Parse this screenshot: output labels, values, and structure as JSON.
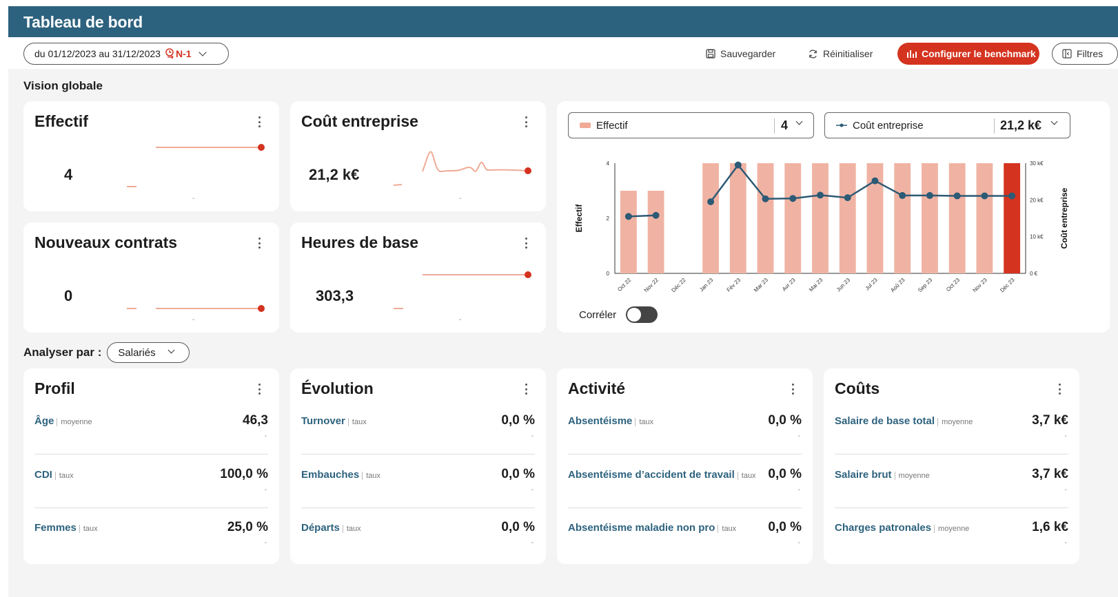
{
  "header": {
    "title": "Tableau de bord"
  },
  "toolbar": {
    "date_range": "du 01/12/2023 au 31/12/2023",
    "compare_label": "N-1",
    "save_label": "Sauvegarder",
    "reset_label": "Réinitialiser",
    "benchmark_label": "Configurer le benchmark",
    "filters_label": "Filtres"
  },
  "global_section": {
    "title": "Vision globale"
  },
  "kpis": [
    {
      "title": "Effectif",
      "value": "4",
      "trend_dash": "-"
    },
    {
      "title": "Coût entreprise",
      "value": "21,2 k€",
      "trend_dash": "-"
    },
    {
      "title": "Nouveaux contrats",
      "value": "0",
      "trend_dash": "-"
    },
    {
      "title": "Heures de base",
      "value": "303,3",
      "trend_dash": "-"
    }
  ],
  "chart_selectors": {
    "left": {
      "label": "Effectif",
      "value": "4"
    },
    "right": {
      "label": "Coût entreprise",
      "value": "21,2 k€"
    }
  },
  "correlate_label": "Corréler",
  "chart_data": {
    "type": "bar",
    "categories": [
      "Oct 22",
      "Nov 22",
      "Déc 22",
      "Jan 23",
      "Fév 23",
      "Mar 23",
      "Avr 23",
      "Mai 23",
      "Jun 23",
      "Jul 23",
      "Aoû 23",
      "Sep 23",
      "Oct 23",
      "Nov 23",
      "Déc 23"
    ],
    "series": [
      {
        "name": "Effectif",
        "type": "bar",
        "axis": "left",
        "values": [
          3,
          3,
          0,
          4,
          4,
          4,
          4,
          4,
          4,
          4,
          4,
          4,
          4,
          4,
          4
        ]
      },
      {
        "name": "Coût entreprise",
        "type": "line",
        "axis": "right",
        "values": [
          15.5,
          15.8,
          null,
          19.5,
          29.5,
          20.3,
          20.4,
          21.3,
          20.6,
          25.2,
          21.2,
          21.2,
          21.1,
          21.1,
          21.1
        ]
      }
    ],
    "highlight_index": 14,
    "ylabel": "Effectif",
    "ylabel_right": "Coût entreprise",
    "yticks_left": [
      "0",
      "2",
      "4"
    ],
    "yticks_right": [
      "0 €",
      "10 k€",
      "20 k€",
      "30 k€"
    ],
    "ylim": [
      0,
      4
    ],
    "ylim_right": [
      0,
      30
    ],
    "colors": {
      "bar": "#f0b3a3",
      "bar_highlight": "#d4331f",
      "line": "#2d5a75"
    }
  },
  "analyse": {
    "label": "Analyser par :",
    "value": "Salariés"
  },
  "metric_cards": [
    {
      "title": "Profil",
      "rows": [
        {
          "name": "Âge",
          "tag": "moyenne",
          "value": "46,3",
          "dash": "-"
        },
        {
          "name": "CDI",
          "tag": "taux",
          "value": "100,0 %",
          "dash": "-"
        },
        {
          "name": "Femmes",
          "tag": "taux",
          "value": "25,0 %",
          "dash": "-"
        }
      ]
    },
    {
      "title": "Évolution",
      "rows": [
        {
          "name": "Turnover",
          "tag": "taux",
          "value": "0,0 %",
          "dash": "-"
        },
        {
          "name": "Embauches",
          "tag": "taux",
          "value": "0,0 %",
          "dash": "-"
        },
        {
          "name": "Départs",
          "tag": "taux",
          "value": "0,0 %",
          "dash": "-"
        }
      ]
    },
    {
      "title": "Activité",
      "rows": [
        {
          "name": "Absentéisme",
          "tag": "taux",
          "value": "0,0 %",
          "dash": "-"
        },
        {
          "name": "Absentéisme d’accident de travail",
          "tag": "taux",
          "value": "0,0 %",
          "dash": "-"
        },
        {
          "name": "Absentéisme maladie non pro",
          "tag": "taux",
          "value": "0,0 %",
          "dash": "-"
        }
      ]
    },
    {
      "title": "Coûts",
      "rows": [
        {
          "name": "Salaire de base total",
          "tag": "moyenne",
          "value": "3,7 k€",
          "dash": "-"
        },
        {
          "name": "Salaire brut",
          "tag": "moyenne",
          "value": "3,7 k€",
          "dash": "-"
        },
        {
          "name": "Charges patronales",
          "tag": "moyenne",
          "value": "1,6 k€",
          "dash": "-"
        }
      ]
    }
  ]
}
